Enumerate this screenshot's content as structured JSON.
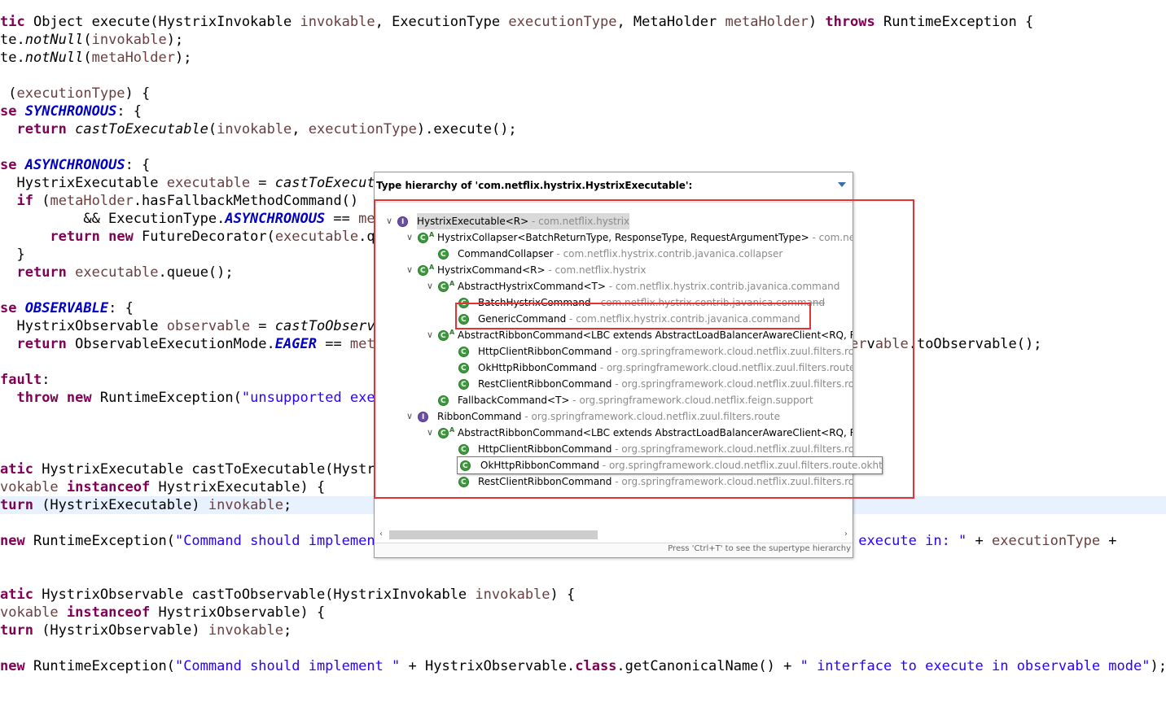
{
  "code_lines": [
    [
      {
        "t": "tic",
        "c": "kw"
      },
      {
        "t": " Object execute(HystrixInvokable "
      },
      {
        "t": "invokable",
        "c": "var"
      },
      {
        "t": ", ExecutionType "
      },
      {
        "t": "executionType",
        "c": "var"
      },
      {
        "t": ", MetaHolder "
      },
      {
        "t": "metaHolder",
        "c": "var"
      },
      {
        "t": ") "
      },
      {
        "t": "throws",
        "c": "kw"
      },
      {
        "t": " RuntimeException {"
      }
    ],
    [
      {
        "t": "te."
      },
      {
        "t": "notNull",
        "c": "it"
      },
      {
        "t": "("
      },
      {
        "t": "invokable",
        "c": "var"
      },
      {
        "t": ");"
      }
    ],
    [
      {
        "t": "te."
      },
      {
        "t": "notNull",
        "c": "it"
      },
      {
        "t": "("
      },
      {
        "t": "metaHolder",
        "c": "var"
      },
      {
        "t": ");"
      }
    ],
    [],
    [
      {
        "t": " ("
      },
      {
        "t": "executionType",
        "c": "var"
      },
      {
        "t": ") {"
      }
    ],
    [
      {
        "t": "se",
        "c": "kw"
      },
      {
        "t": " "
      },
      {
        "t": "SYNCHRONOUS",
        "c": "fld"
      },
      {
        "t": ": {"
      }
    ],
    [
      {
        "t": "  "
      },
      {
        "t": "return",
        "c": "kw"
      },
      {
        "t": " "
      },
      {
        "t": "castToExecutable",
        "c": "it"
      },
      {
        "t": "("
      },
      {
        "t": "invokable",
        "c": "var"
      },
      {
        "t": ", "
      },
      {
        "t": "executionType",
        "c": "var"
      },
      {
        "t": ").execute();"
      }
    ],
    [],
    [
      {
        "t": "se",
        "c": "kw"
      },
      {
        "t": " "
      },
      {
        "t": "ASYNCHRONOUS",
        "c": "fld"
      },
      {
        "t": ": {"
      }
    ],
    [
      {
        "t": "  HystrixExecutable "
      },
      {
        "t": "executable",
        "c": "var"
      },
      {
        "t": " = "
      },
      {
        "t": "castToExecuta",
        "c": "it"
      }
    ],
    [
      {
        "t": "  "
      },
      {
        "t": "if",
        "c": "kw"
      },
      {
        "t": " ("
      },
      {
        "t": "metaHolder",
        "c": "var"
      },
      {
        "t": ".hasFallbackMethodCommand()"
      }
    ],
    [
      {
        "t": "          && ExecutionType."
      },
      {
        "t": "ASYNCHRONOUS",
        "c": "fld"
      },
      {
        "t": " == "
      },
      {
        "t": "met",
        "c": "var"
      }
    ],
    [
      {
        "t": "      "
      },
      {
        "t": "return",
        "c": "kw"
      },
      {
        "t": " "
      },
      {
        "t": "new",
        "c": "kw"
      },
      {
        "t": " FutureDecorator("
      },
      {
        "t": "executable",
        "c": "var"
      },
      {
        "t": ".qu"
      }
    ],
    [
      {
        "t": "  }"
      }
    ],
    [
      {
        "t": "  "
      },
      {
        "t": "return",
        "c": "kw"
      },
      {
        "t": " "
      },
      {
        "t": "executable",
        "c": "var"
      },
      {
        "t": ".queue();"
      }
    ],
    [],
    [
      {
        "t": "se",
        "c": "kw"
      },
      {
        "t": " "
      },
      {
        "t": "OBSERVABLE",
        "c": "fld"
      },
      {
        "t": ": {"
      }
    ],
    [
      {
        "t": "  HystrixObservable "
      },
      {
        "t": "observable",
        "c": "var"
      },
      {
        "t": " = "
      },
      {
        "t": "castToObserva",
        "c": "it"
      }
    ],
    [
      {
        "t": "  "
      },
      {
        "t": "return",
        "c": "kw"
      },
      {
        "t": " ObservableExecutionMode."
      },
      {
        "t": "EAGER",
        "c": "fld"
      },
      {
        "t": " == "
      },
      {
        "t": "meta",
        "c": "var"
      },
      {
        "t": "                                                   : "
      },
      {
        "t": "obser",
        "c": "var"
      },
      {
        "t": "v"
      },
      {
        "t": "able",
        "c": "var"
      },
      {
        "t": ".toObservable();"
      }
    ],
    [],
    [
      {
        "t": "fault",
        "c": "kw"
      },
      {
        "t": ":"
      }
    ],
    [
      {
        "t": "  "
      },
      {
        "t": "throw",
        "c": "kw"
      },
      {
        "t": " "
      },
      {
        "t": "new",
        "c": "kw"
      },
      {
        "t": " RuntimeException("
      },
      {
        "t": "\"unsupported exec",
        "c": "str"
      }
    ],
    [],
    [],
    [],
    [
      {
        "t": "atic",
        "c": "kw"
      },
      {
        "t": " HystrixExecutable castToExecutable(Hystri"
      }
    ],
    [
      {
        "t": "vokable",
        "c": "var"
      },
      {
        "t": " "
      },
      {
        "t": "instanceof",
        "c": "kw"
      },
      {
        "t": " HystrixExecutable) {"
      }
    ],
    [
      {
        "t": "turn",
        "c": "kw"
      },
      {
        "t": " (HystrixExecutable) "
      },
      {
        "t": "invokable",
        "c": "var"
      },
      {
        "t": ";"
      }
    ],
    [],
    [
      {
        "t": "new",
        "c": "kw"
      },
      {
        "t": " RuntimeException("
      },
      {
        "t": "\"Command should implement",
        "c": "str"
      },
      {
        "t": "                                                   "
      },
      {
        "t": "ce to execute in: \"",
        "c": "str"
      },
      {
        "t": " + "
      },
      {
        "t": "executionType",
        "c": "var"
      },
      {
        "t": " +"
      }
    ],
    [],
    [],
    [
      {
        "t": "atic",
        "c": "kw"
      },
      {
        "t": " HystrixObservable castToObservable(HystrixInvokable "
      },
      {
        "t": "invokable",
        "c": "var"
      },
      {
        "t": ") {"
      }
    ],
    [
      {
        "t": "vokable",
        "c": "var"
      },
      {
        "t": " "
      },
      {
        "t": "instanceof",
        "c": "kw"
      },
      {
        "t": " HystrixObservable) {"
      }
    ],
    [
      {
        "t": "turn",
        "c": "kw"
      },
      {
        "t": " (HystrixObservable) "
      },
      {
        "t": "invokable",
        "c": "var"
      },
      {
        "t": ";"
      }
    ],
    [],
    [
      {
        "t": "new",
        "c": "kw"
      },
      {
        "t": " RuntimeException("
      },
      {
        "t": "\"Command should implement \"",
        "c": "str"
      },
      {
        "t": " + HystrixObservable."
      },
      {
        "t": "class",
        "c": "kw"
      },
      {
        "t": ".getCanonicalName() + "
      },
      {
        "t": "\" interface to execute in observable mode\"",
        "c": "str"
      },
      {
        "t": ");"
      }
    ]
  ],
  "highlighted_line": 27,
  "popup": {
    "title": "Type hierarchy of 'com.netflix.hystrix.HystrixExecutable':",
    "footer": "Press 'Ctrl+T' to see the supertype hierarchy",
    "rows": [
      {
        "indent": 0,
        "twist": "v",
        "icon": "interface",
        "abstract": false,
        "name": "HystrixExecutable<R>",
        "pkg": "com.netflix.hystrix",
        "selected": true,
        "strike": false
      },
      {
        "indent": 1,
        "twist": "v",
        "icon": "class",
        "abstract": true,
        "name": "HystrixCollapser<BatchReturnType, ResponseType, RequestArgumentType>",
        "pkg": "com.netfl",
        "selected": false,
        "strike": false
      },
      {
        "indent": 2,
        "twist": "",
        "icon": "class",
        "abstract": false,
        "name": "CommandCollapser",
        "pkg": "com.netflix.hystrix.contrib.javanica.collapser",
        "selected": false,
        "strike": false
      },
      {
        "indent": 1,
        "twist": "v",
        "icon": "class",
        "abstract": true,
        "name": "HystrixCommand<R>",
        "pkg": "com.netflix.hystrix",
        "selected": false,
        "strike": false
      },
      {
        "indent": 2,
        "twist": "v",
        "icon": "class",
        "abstract": true,
        "name": "AbstractHystrixCommand<T>",
        "pkg": "com.netflix.hystrix.contrib.javanica.command",
        "selected": false,
        "strike": false
      },
      {
        "indent": 3,
        "twist": "",
        "icon": "class",
        "abstract": false,
        "name": "BatchHystrixCommand",
        "pkg": "com.netflix.hystrix.contrib.javanica.command",
        "selected": false,
        "strike": true
      },
      {
        "indent": 3,
        "twist": "",
        "icon": "class",
        "abstract": false,
        "name": "GenericCommand",
        "pkg": "com.netflix.hystrix.contrib.javanica.command",
        "selected": false,
        "strike": false
      },
      {
        "indent": 2,
        "twist": "v",
        "icon": "class",
        "abstract": true,
        "name": "AbstractRibbonCommand<LBC extends AbstractLoadBalancerAwareClient<RQ, RS",
        "pkg": "",
        "selected": false,
        "strike": false
      },
      {
        "indent": 3,
        "twist": "",
        "icon": "class",
        "abstract": false,
        "name": "HttpClientRibbonCommand",
        "pkg": "org.springframework.cloud.netflix.zuul.filters.rout",
        "selected": false,
        "strike": false
      },
      {
        "indent": 3,
        "twist": "",
        "icon": "class",
        "abstract": false,
        "name": "OkHttpRibbonCommand",
        "pkg": "org.springframework.cloud.netflix.zuul.filters.route.o",
        "selected": false,
        "strike": false
      },
      {
        "indent": 3,
        "twist": "",
        "icon": "class",
        "abstract": false,
        "name": "RestClientRibbonCommand",
        "pkg": "org.springframework.cloud.netflix.zuul.filters.rout",
        "selected": false,
        "strike": false
      },
      {
        "indent": 2,
        "twist": "",
        "icon": "class",
        "abstract": false,
        "name": "FallbackCommand<T>",
        "pkg": "org.springframework.cloud.netflix.feign.support",
        "selected": false,
        "strike": false
      },
      {
        "indent": 1,
        "twist": "v",
        "icon": "interface",
        "abstract": false,
        "name": "RibbonCommand",
        "pkg": "org.springframework.cloud.netflix.zuul.filters.route",
        "selected": false,
        "strike": false
      },
      {
        "indent": 2,
        "twist": "v",
        "icon": "class",
        "abstract": true,
        "name": "AbstractRibbonCommand<LBC extends AbstractLoadBalancerAwareClient<RQ, RS",
        "pkg": "",
        "selected": false,
        "strike": false
      },
      {
        "indent": 3,
        "twist": "",
        "icon": "class",
        "abstract": false,
        "name": "HttpClientRibbonCommand",
        "pkg": "org.springframework.cloud.netflix.zuul.filters.rout",
        "selected": false,
        "strike": false
      },
      {
        "indent": 3,
        "twist": "",
        "icon": "class",
        "abstract": false,
        "name": "OkHttpRibbonCommand",
        "pkg": "org.springframework.cloud.netflix.zuul.filters.route.okhttp",
        "selected": false,
        "strike": false
      },
      {
        "indent": 3,
        "twist": "",
        "icon": "class",
        "abstract": false,
        "name": "RestClientRibbonCommand",
        "pkg": "org.springframework.cloud.netflix.zuul.filters.rout",
        "selected": false,
        "strike": false
      }
    ]
  },
  "tooltip": {
    "name": "OkHttpRibbonCommand",
    "pkg": "org.springframework.cloud.netflix.zuul.filters.route.okhttp"
  },
  "colors": {
    "annotation_red": "#e53333",
    "keyword": "#7f0055",
    "string": "#2a00ff",
    "field": "#0000c0",
    "variable": "#6a3e3e"
  }
}
